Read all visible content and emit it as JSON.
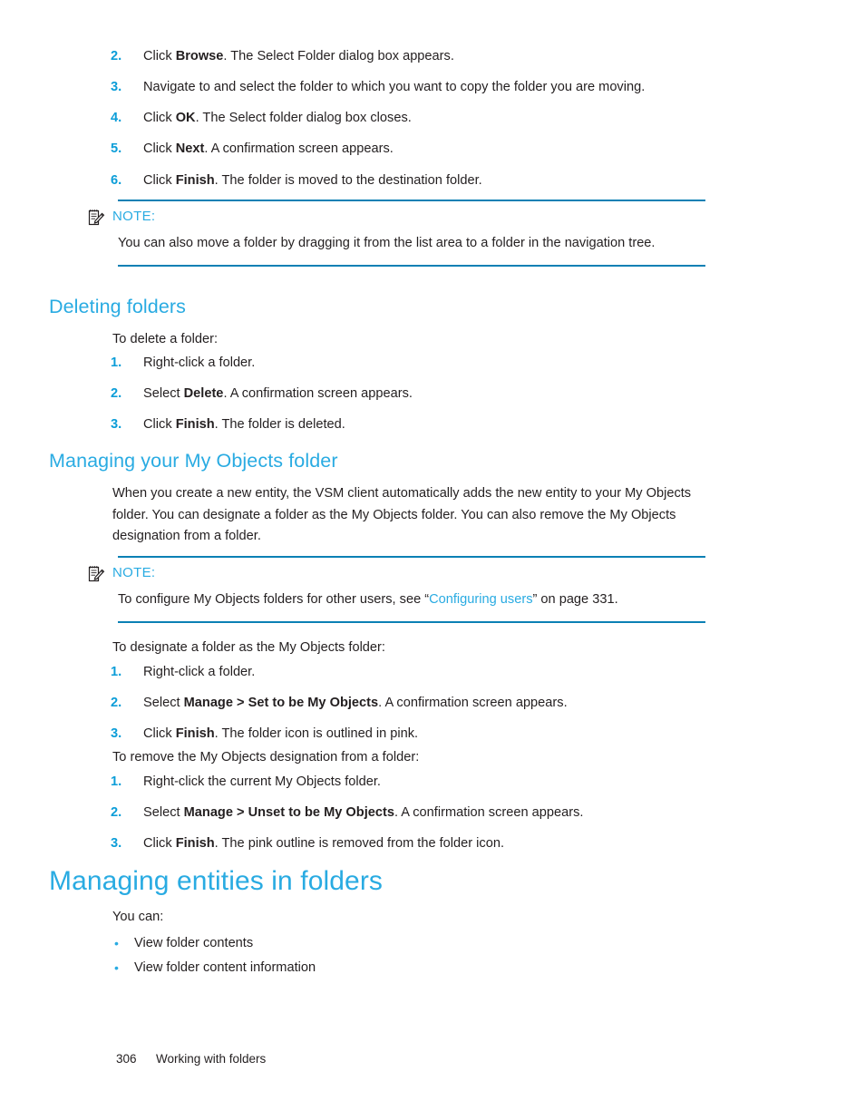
{
  "colors": {
    "heading_blue": "#29abe2",
    "step_number_blue": "#0b9dd8",
    "note_rule_blue": "#0b80b4",
    "body_text": "#231f20",
    "link_blue": "#29abe2"
  },
  "top_steps": [
    {
      "num": "2.",
      "pre": "Click ",
      "bold": "Browse",
      "post": ". The Select Folder dialog box appears."
    },
    {
      "num": "3.",
      "pre": "Navigate to and select the folder to which you want to copy the folder you are moving.",
      "bold": "",
      "post": ""
    },
    {
      "num": "4.",
      "pre": "Click ",
      "bold": "OK",
      "post": ". The Select folder dialog box closes."
    },
    {
      "num": "5.",
      "pre": "Click ",
      "bold": "Next",
      "post": ". A confirmation screen appears."
    },
    {
      "num": "6.",
      "pre": "Click ",
      "bold": "Finish",
      "post": ". The folder is moved to the destination folder."
    }
  ],
  "note_1": {
    "icon": "note-pad-pen-icon",
    "label": "NOTE:",
    "text": "You can also move a folder by dragging it from the list area to a folder in the navigation tree."
  },
  "section_deleting": {
    "heading": "Deleting folders",
    "intro": "To delete a folder:",
    "steps": [
      {
        "num": "1.",
        "pre": "Right-click a folder.",
        "bold": "",
        "post": ""
      },
      {
        "num": "2.",
        "pre": "Select ",
        "bold": "Delete",
        "post": ". A confirmation screen appears."
      },
      {
        "num": "3.",
        "pre": "Click ",
        "bold": "Finish",
        "post": ". The folder is deleted."
      }
    ]
  },
  "section_myobjects": {
    "heading": "Managing your My Objects folder",
    "paragraph": "When you create a new entity, the VSM client automatically adds the new entity to your My Objects folder. You can designate a folder as the My Objects folder. You can also remove the My Objects designation from a folder.",
    "note": {
      "icon": "note-pad-pen-icon",
      "label": "NOTE:",
      "text_before": "To configure My Objects folders for other users, see “",
      "link": "Configuring users",
      "text_after": "” on page 331."
    },
    "designate_intro": "To designate a folder as the My Objects folder:",
    "designate_steps": [
      {
        "num": "1.",
        "pre": "Right-click a folder.",
        "bold": "",
        "post": ""
      },
      {
        "num": "2.",
        "pre": "Select ",
        "bold": "Manage > Set to be My Objects",
        "post": ". A confirmation screen appears."
      },
      {
        "num": "3.",
        "pre": "Click ",
        "bold": "Finish",
        "post": ". The folder icon is outlined in pink."
      }
    ],
    "remove_intro": "To remove the My Objects designation from a folder:",
    "remove_steps": [
      {
        "num": "1.",
        "pre": "Right-click the current My Objects folder.",
        "bold": "",
        "post": ""
      },
      {
        "num": "2.",
        "pre": "Select ",
        "bold": "Manage > Unset to be My Objects",
        "post": ". A confirmation screen appears."
      },
      {
        "num": "3.",
        "pre": "Click ",
        "bold": "Finish",
        "post": ". The pink outline is removed from the folder icon."
      }
    ]
  },
  "section_entities": {
    "heading": "Managing entities in folders",
    "intro": "You can:",
    "bullets": [
      "View folder contents",
      "View folder content information"
    ]
  },
  "footer": {
    "page_number": "306",
    "chapter_title": "Working with folders"
  }
}
